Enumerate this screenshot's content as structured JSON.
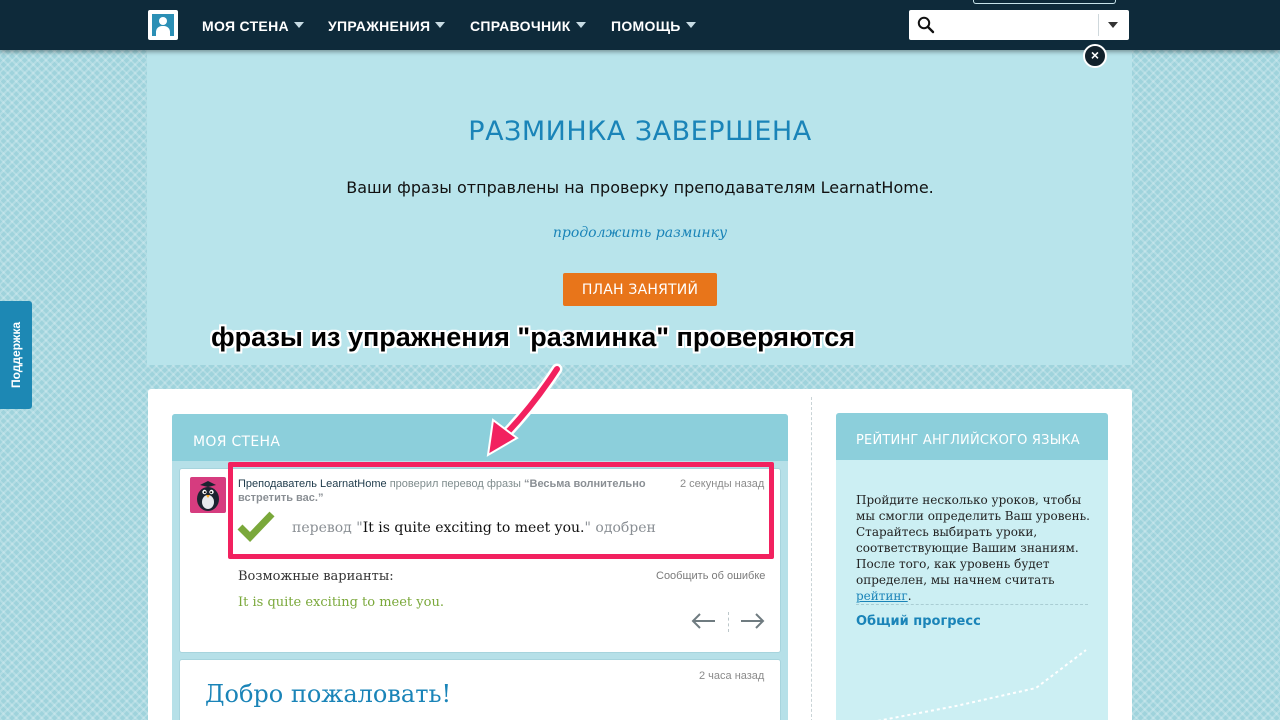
{
  "nav": {
    "logo_icon": "user-icon",
    "items": [
      {
        "label": "МОЯ СТЕНА"
      },
      {
        "label": "УПРАЖНЕНИЯ"
      },
      {
        "label": "СПРАВОЧНИК"
      },
      {
        "label": "ПОМОЩЬ"
      }
    ],
    "search": {
      "value": "",
      "placeholder": ""
    }
  },
  "support_tab": {
    "label": "Поддержка"
  },
  "warmup": {
    "title": "РАЗМИНКА ЗАВЕРШЕНА",
    "subtitle": "Ваши фразы отправлены на проверку преподавателям LearnatHome.",
    "continue_link": "продолжить разминку",
    "plan_button": "ПЛАН ЗАНЯТИЙ"
  },
  "annotation": {
    "text": "фразы из упражнения \"разминка\" проверяются",
    "color": "#f2215f"
  },
  "wall": {
    "title": "МОЯ СТЕНА",
    "activity": {
      "who": "Преподаватель LearnatHome",
      "action": " проверил перевод фразы ",
      "phrase": "“Весьма волнительно встретить вас.”",
      "time": "2 секунды назад",
      "translation_prefix": "перевод \"",
      "translation_value": "It is quite exciting to meet you.",
      "translation_suffix": "\" одобрен",
      "variants_label": "Возможные варианты:",
      "report_link": "Сообщить об ошибке",
      "variant_value": "It is quite exciting to meet you."
    },
    "welcome": {
      "time": "2 часа назад",
      "title": "Добро пожаловать!"
    }
  },
  "rating": {
    "title": "РЕЙТИНГ АНГЛИЙСКОГО ЯЗЫКА",
    "text": "Пройдите несколько уроков, чтобы мы смогли определить Ваш уровень. Старайтесь выбирать уроки, соответствующие Вашим знаниям. После того, как уровень будет определен, мы начнем считать ",
    "link": "рейтинг",
    "text_end": ".",
    "progress_label": "Общий прогресс"
  },
  "colors": {
    "topbar": "#0e2a3a",
    "accent_blue": "#1a84b8",
    "plan_button": "#e8751a",
    "highlight": "#f2215f",
    "check_green": "#7aa83a"
  }
}
